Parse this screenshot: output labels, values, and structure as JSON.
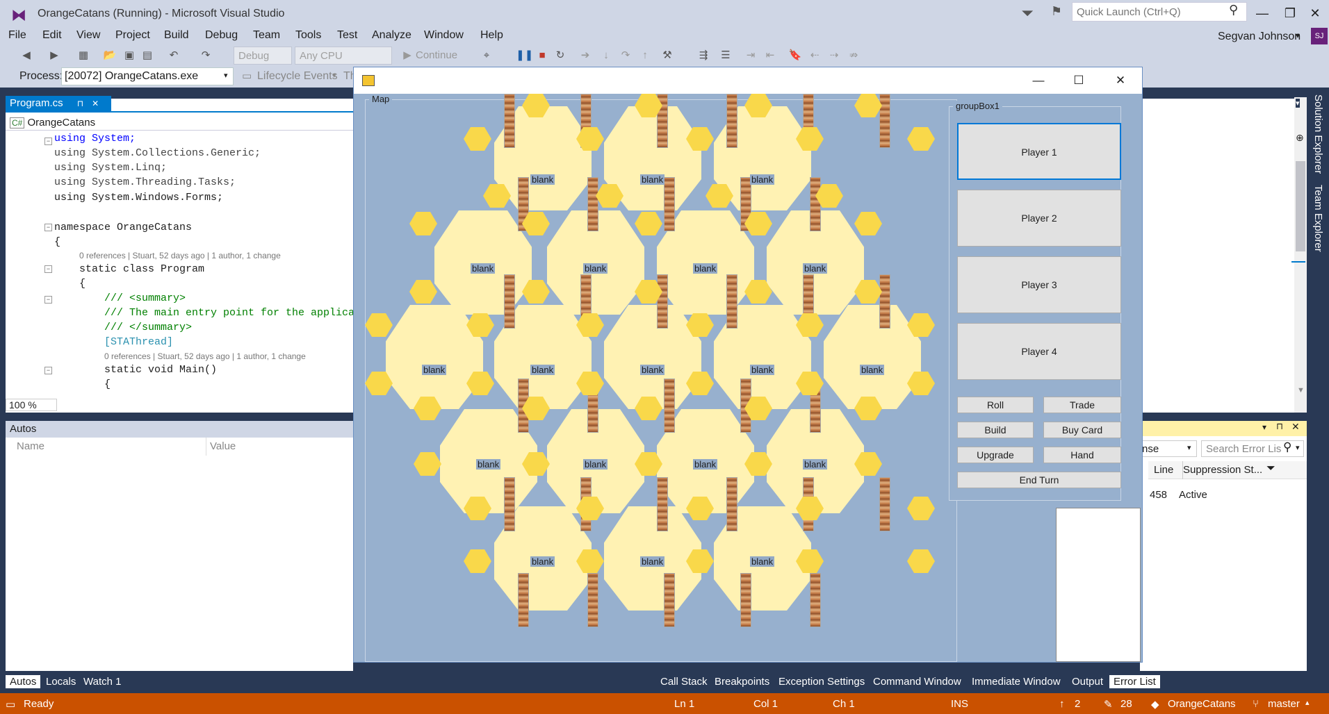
{
  "window": {
    "title": "OrangeCatans (Running) - Microsoft Visual Studio"
  },
  "quick_launch": {
    "placeholder": "Quick Launch (Ctrl+Q)"
  },
  "menu": [
    "File",
    "Edit",
    "View",
    "Project",
    "Build",
    "Debug",
    "Team",
    "Tools",
    "Test",
    "Analyze",
    "Window",
    "Help"
  ],
  "user": {
    "name": "Segvan Johnson",
    "initials": "SJ"
  },
  "toolbar": {
    "config": "Debug",
    "platform": "Any CPU",
    "continue_label": "Continue"
  },
  "process": {
    "label": "Process:",
    "value": "[20072] OrangeCatans.exe",
    "lifecycle": "Lifecycle Events",
    "trailing": "Th"
  },
  "editor": {
    "tab": "Program.cs",
    "class_dropdown": "OrangeCatans",
    "zoom": "100 %",
    "lines": [
      "using System;",
      "using System.Collections.Generic;",
      "using System.Linq;",
      "using System.Threading.Tasks;",
      "using System.Windows.Forms;",
      "",
      "namespace OrangeCatans",
      "{",
      "0 references | Stuart, 52 days ago | 1 author, 1 change",
      "static class Program",
      "{",
      "/// <summary>",
      "/// The main entry point for the applica",
      "/// </summary>",
      "[STAThread]",
      "0 references | Stuart, 52 days ago | 1 author, 1 change",
      "static void Main()",
      "{"
    ]
  },
  "autos": {
    "title": "Autos",
    "col_name": "Name",
    "col_value": "Value"
  },
  "bottom_tabs_left": [
    "Autos",
    "Locals",
    "Watch 1"
  ],
  "bottom_tabs_right": [
    "Call Stack",
    "Breakpoints",
    "Exception Settings",
    "Command Window",
    "Immediate Window",
    "Output",
    "Error List"
  ],
  "error_list": {
    "filter_partial": "nse",
    "search_placeholder": "Search Error Lis",
    "col_line": "Line",
    "col_suppression": "Suppression St...",
    "row_line": "458",
    "row_state": "Active"
  },
  "side_tabs": [
    "Solution Explorer",
    "Team Explorer"
  ],
  "status": {
    "ready": "Ready",
    "ln": "Ln 1",
    "col": "Col 1",
    "ch": "Ch 1",
    "mode": "INS",
    "up": "2",
    "edits": "28",
    "repo": "OrangeCatans",
    "branch": "master"
  },
  "form": {
    "map_label": "Map",
    "group_label": "groupBox1",
    "players": [
      "Player 1",
      "Player 2",
      "Player 3",
      "Player 4"
    ],
    "actions": [
      "Roll",
      "Trade",
      "Build",
      "Buy Card",
      "Upgrade",
      "Hand"
    ],
    "end_turn": "End Turn",
    "tile_label": "blank"
  },
  "colors": {
    "accent": "#007acc",
    "status_bar": "#ca5100",
    "form_bg": "#97b0ce",
    "tile": "#fff2b3",
    "node": "#f9d84a"
  }
}
